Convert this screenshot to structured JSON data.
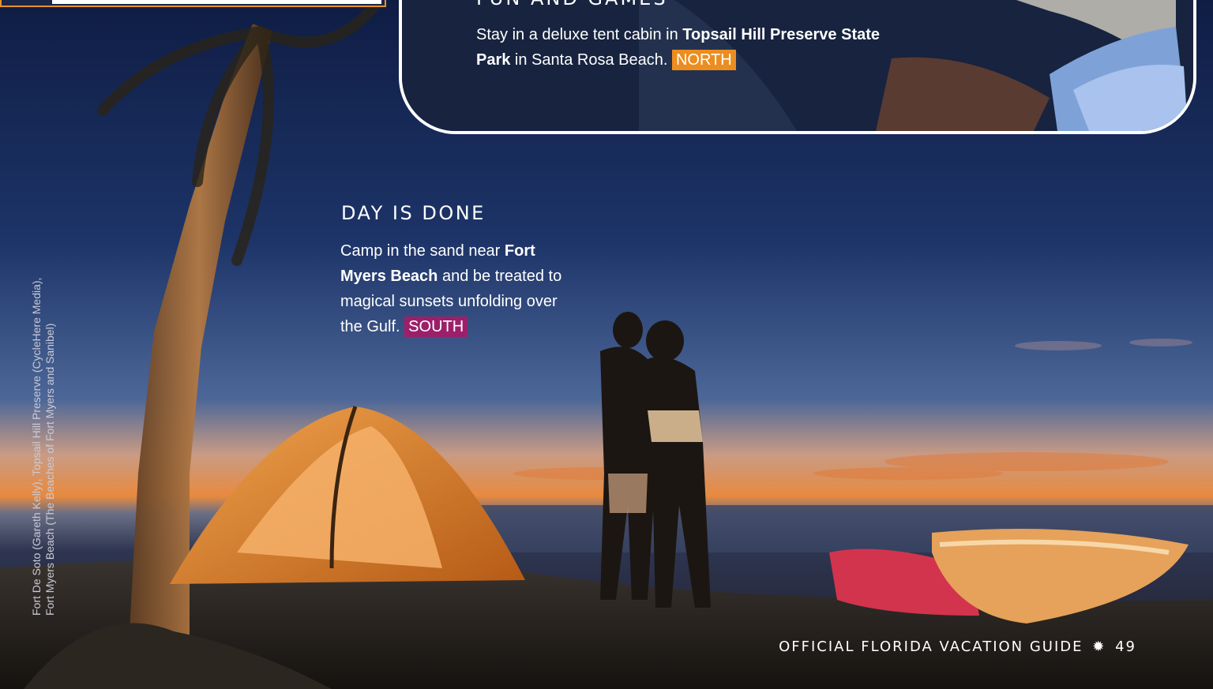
{
  "card": {
    "title": "FUN AND GAMES",
    "text_pre": "Stay in a deluxe tent cabin in ",
    "text_bold": "Topsail Hill Preserve State Park",
    "text_post": " in Santa Rosa Beach.",
    "region": "NORTH"
  },
  "feature": {
    "title": "DAY IS DONE",
    "text_pre": "Camp in the sand near ",
    "text_bold": "Fort Myers Beach",
    "text_post": " and be treated to magical sunsets unfolding over the Gulf.",
    "region": "SOUTH"
  },
  "credits": {
    "line1": "Fort De Soto (Gareth Kelly), Topsail Hill Preserve (CycleHere Media),",
    "line2": "Fort Myers Beach (The Beaches of Fort Myers and Sanibel)"
  },
  "footer": {
    "guide": "OFFICIAL FLORIDA VACATION GUIDE",
    "star_icon": "asterisk-star",
    "page": "49"
  },
  "colors": {
    "north": "#ec8d1f",
    "south": "#9c1f6a"
  }
}
